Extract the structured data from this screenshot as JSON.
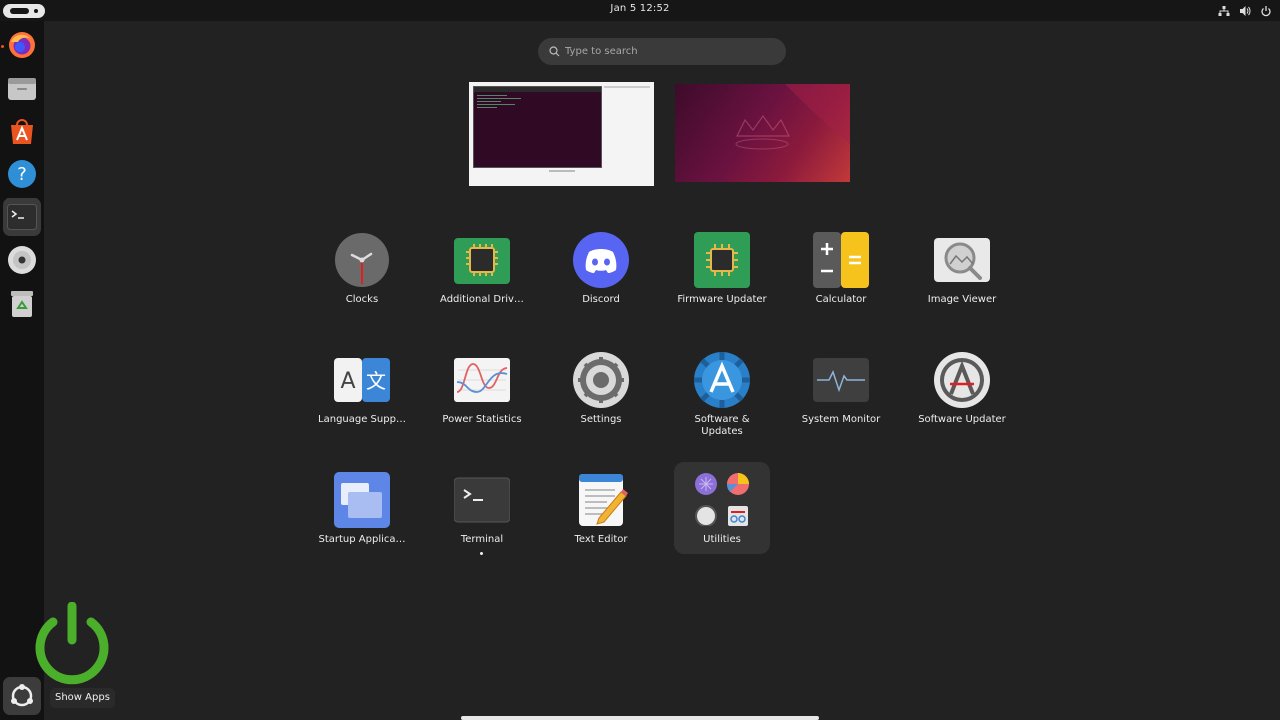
{
  "topbar": {
    "clock": "Jan 5  12:52",
    "tray_icons": [
      "network-icon",
      "volume-icon",
      "power-icon"
    ]
  },
  "dock": {
    "items": [
      {
        "name": "Firefox",
        "icon": "firefox-icon",
        "running": true
      },
      {
        "name": "Files",
        "icon": "files-icon"
      },
      {
        "name": "App Center",
        "icon": "app-center-icon"
      },
      {
        "name": "Help",
        "icon": "help-icon"
      },
      {
        "name": "Terminal",
        "icon": "terminal-icon",
        "active": true
      },
      {
        "name": "Disc",
        "icon": "cd-icon"
      },
      {
        "name": "Trash",
        "icon": "trash-icon"
      }
    ],
    "show_apps_tooltip": "Show Apps"
  },
  "search": {
    "placeholder": "Type to search"
  },
  "apps": [
    {
      "label": "Clocks",
      "icon": "clock-icon"
    },
    {
      "label": "Additional Driv…",
      "icon": "chip-icon"
    },
    {
      "label": "Discord",
      "icon": "discord-icon"
    },
    {
      "label": "Firmware Updater",
      "icon": "firmware-icon"
    },
    {
      "label": "Calculator",
      "icon": "calculator-icon"
    },
    {
      "label": "Image Viewer",
      "icon": "image-viewer-icon"
    },
    {
      "label": "Language Supp…",
      "icon": "language-icon"
    },
    {
      "label": "Power Statistics",
      "icon": "power-stats-icon"
    },
    {
      "label": "Settings",
      "icon": "settings-icon"
    },
    {
      "label": "Software & Updates",
      "icon": "software-updates-icon"
    },
    {
      "label": "System Monitor",
      "icon": "system-monitor-icon"
    },
    {
      "label": "Software Updater",
      "icon": "software-updater-icon"
    },
    {
      "label": "Startup Applica…",
      "icon": "startup-icon"
    },
    {
      "label": "Terminal",
      "icon": "terminal-icon",
      "running": true
    },
    {
      "label": "Text Editor",
      "icon": "text-editor-icon"
    },
    {
      "label": "Utilities",
      "icon": "folder-icon",
      "selected": true
    }
  ],
  "colors": {
    "accent": "#e95420",
    "background": "#222222",
    "dock": "#121212"
  }
}
